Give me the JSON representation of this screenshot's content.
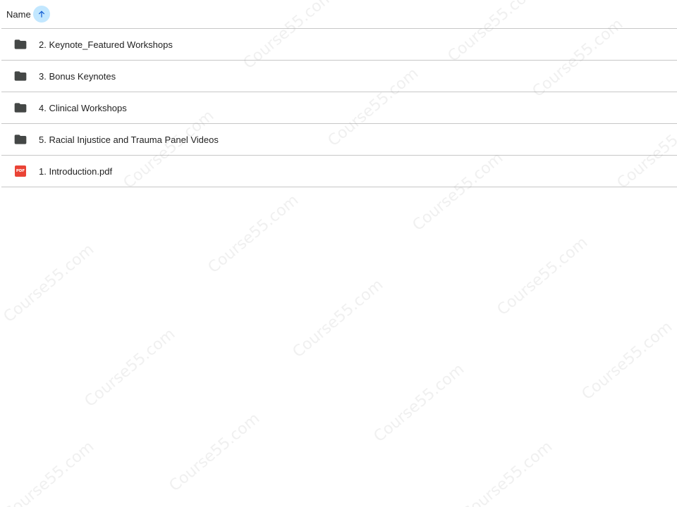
{
  "header": {
    "column_label": "Name",
    "sort_icon": "arrow-up-icon"
  },
  "rows": [
    {
      "label": "2. Keynote_Featured Workshops",
      "icon": "folder-icon"
    },
    {
      "label": "3. Bonus Keynotes",
      "icon": "folder-icon"
    },
    {
      "label": "4. Clinical Workshops",
      "icon": "folder-icon"
    },
    {
      "label": "5. Racial Injustice and Trauma Panel Videos",
      "icon": "folder-icon"
    },
    {
      "label": "1. Introduction.pdf",
      "icon": "pdf-icon",
      "badge": "PDF"
    }
  ],
  "watermark": "Course55.com",
  "colors": {
    "sort_bg": "#c2e7ff",
    "pdf_red": "#ea4335",
    "folder": "#444746",
    "divider": "#c7c7c7"
  }
}
